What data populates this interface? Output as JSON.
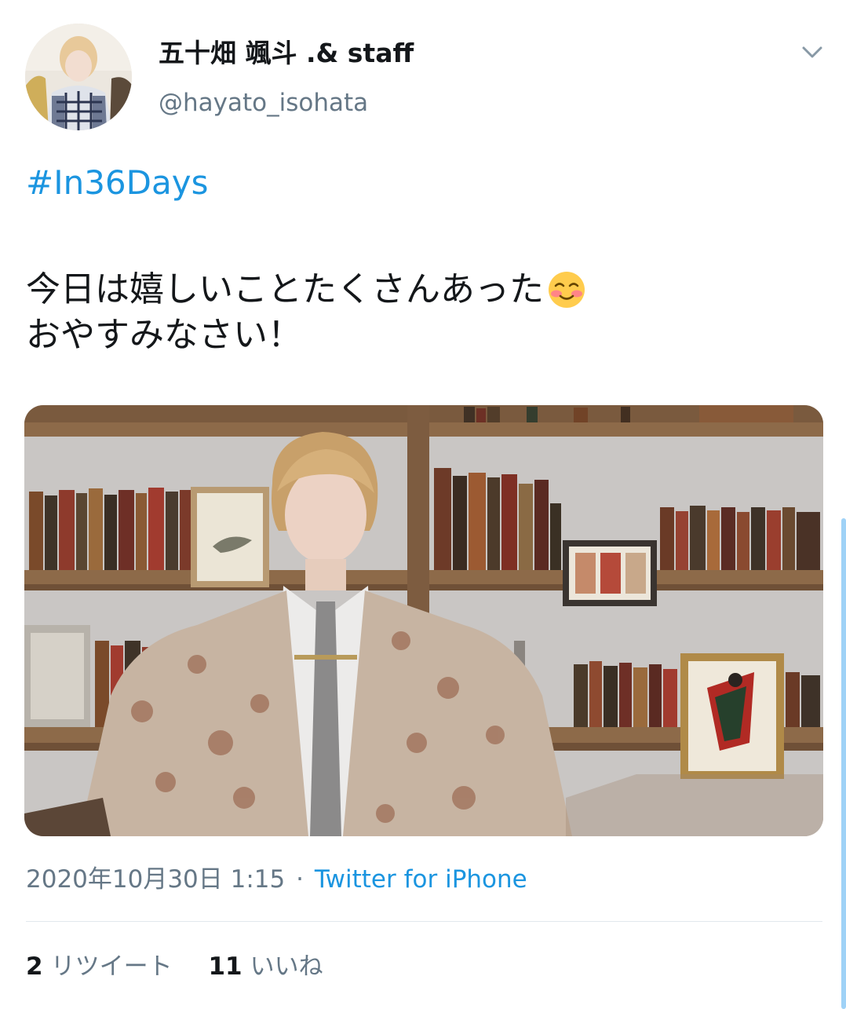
{
  "tweet": {
    "author": {
      "display_name": "五十畑 颯斗 .& staff",
      "handle": "@hayato_isohata"
    },
    "hashtag": "#In36Days",
    "body": {
      "line1": "今日は嬉しいことたくさんあった",
      "line2": "おやすみなさい！",
      "emoji": "smiling-face-with-blush-icon"
    },
    "timestamp": "2020年10月30日 1:15",
    "separator": "·",
    "source": "Twitter for iPhone",
    "stats": {
      "retweets_count": "2",
      "retweets_label": "リツイート",
      "likes_count": "11",
      "likes_label": "いいね"
    }
  },
  "icons": {
    "menu": "chevron-down-icon",
    "avatar": "avatar"
  },
  "colors": {
    "link": "#1b95e0",
    "secondary_text": "#657786",
    "primary_text": "#14171a",
    "divider": "#e1e8ed"
  }
}
